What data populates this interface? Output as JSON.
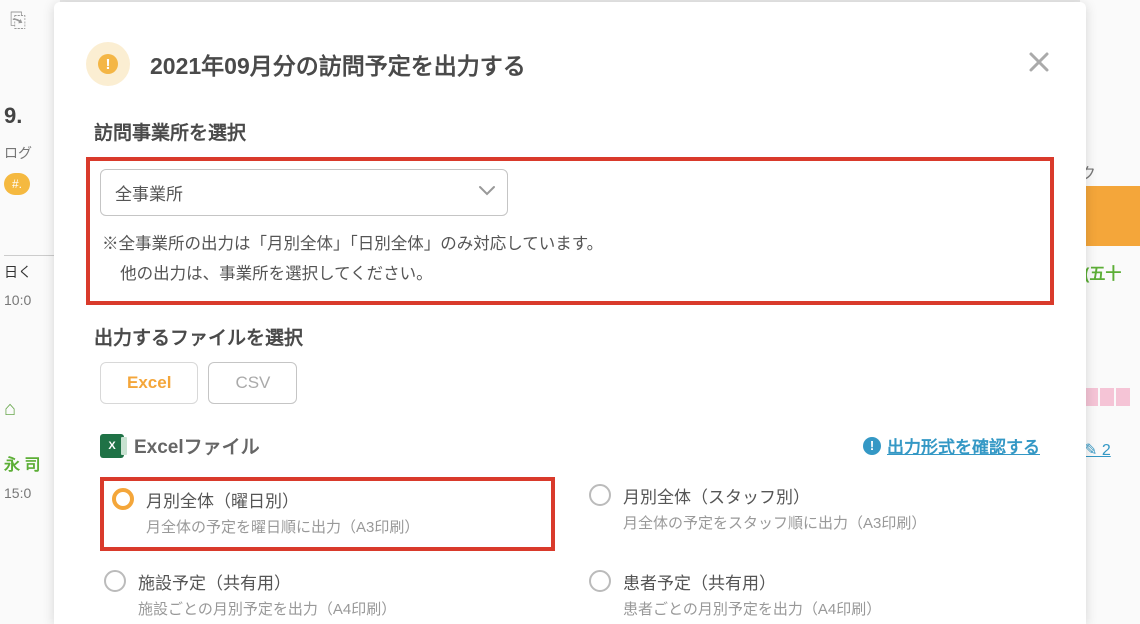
{
  "background": {
    "date_fragment": "9.",
    "loku": "ログ",
    "pill": "#.",
    "hiku": "日く",
    "time10": "10:0",
    "green": "永 司",
    "time15": "15:0",
    "right_ku": "ク",
    "right_green": "(五十",
    "edit": "✎ 2"
  },
  "modal": {
    "title": "2021年09月分の訪問予定を出力する",
    "section_office": "訪問事業所を選択",
    "select_value": "全事業所",
    "note_line1": "※全事業所の出力は「月別全体」「日別全体」のみ対応しています。",
    "note_line2": "他の出力は、事業所を選択してください。",
    "section_file": "出力するファイルを選択",
    "tabs": {
      "excel": "Excel",
      "csv": "CSV"
    },
    "file_section_label": "Excelファイル",
    "format_link": "出力形式を確認する",
    "options": [
      {
        "title": "月別全体（曜日別）",
        "desc": "月全体の予定を曜日順に出力（A3印刷）"
      },
      {
        "title": "月別全体（スタッフ別）",
        "desc": "月全体の予定をスタッフ順に出力（A3印刷）"
      },
      {
        "title": "施設予定（共有用）",
        "desc": "施設ごとの月別予定を出力（A4印刷）"
      },
      {
        "title": "患者予定（共有用）",
        "desc": "患者ごとの月別予定を出力（A4印刷）"
      }
    ]
  }
}
